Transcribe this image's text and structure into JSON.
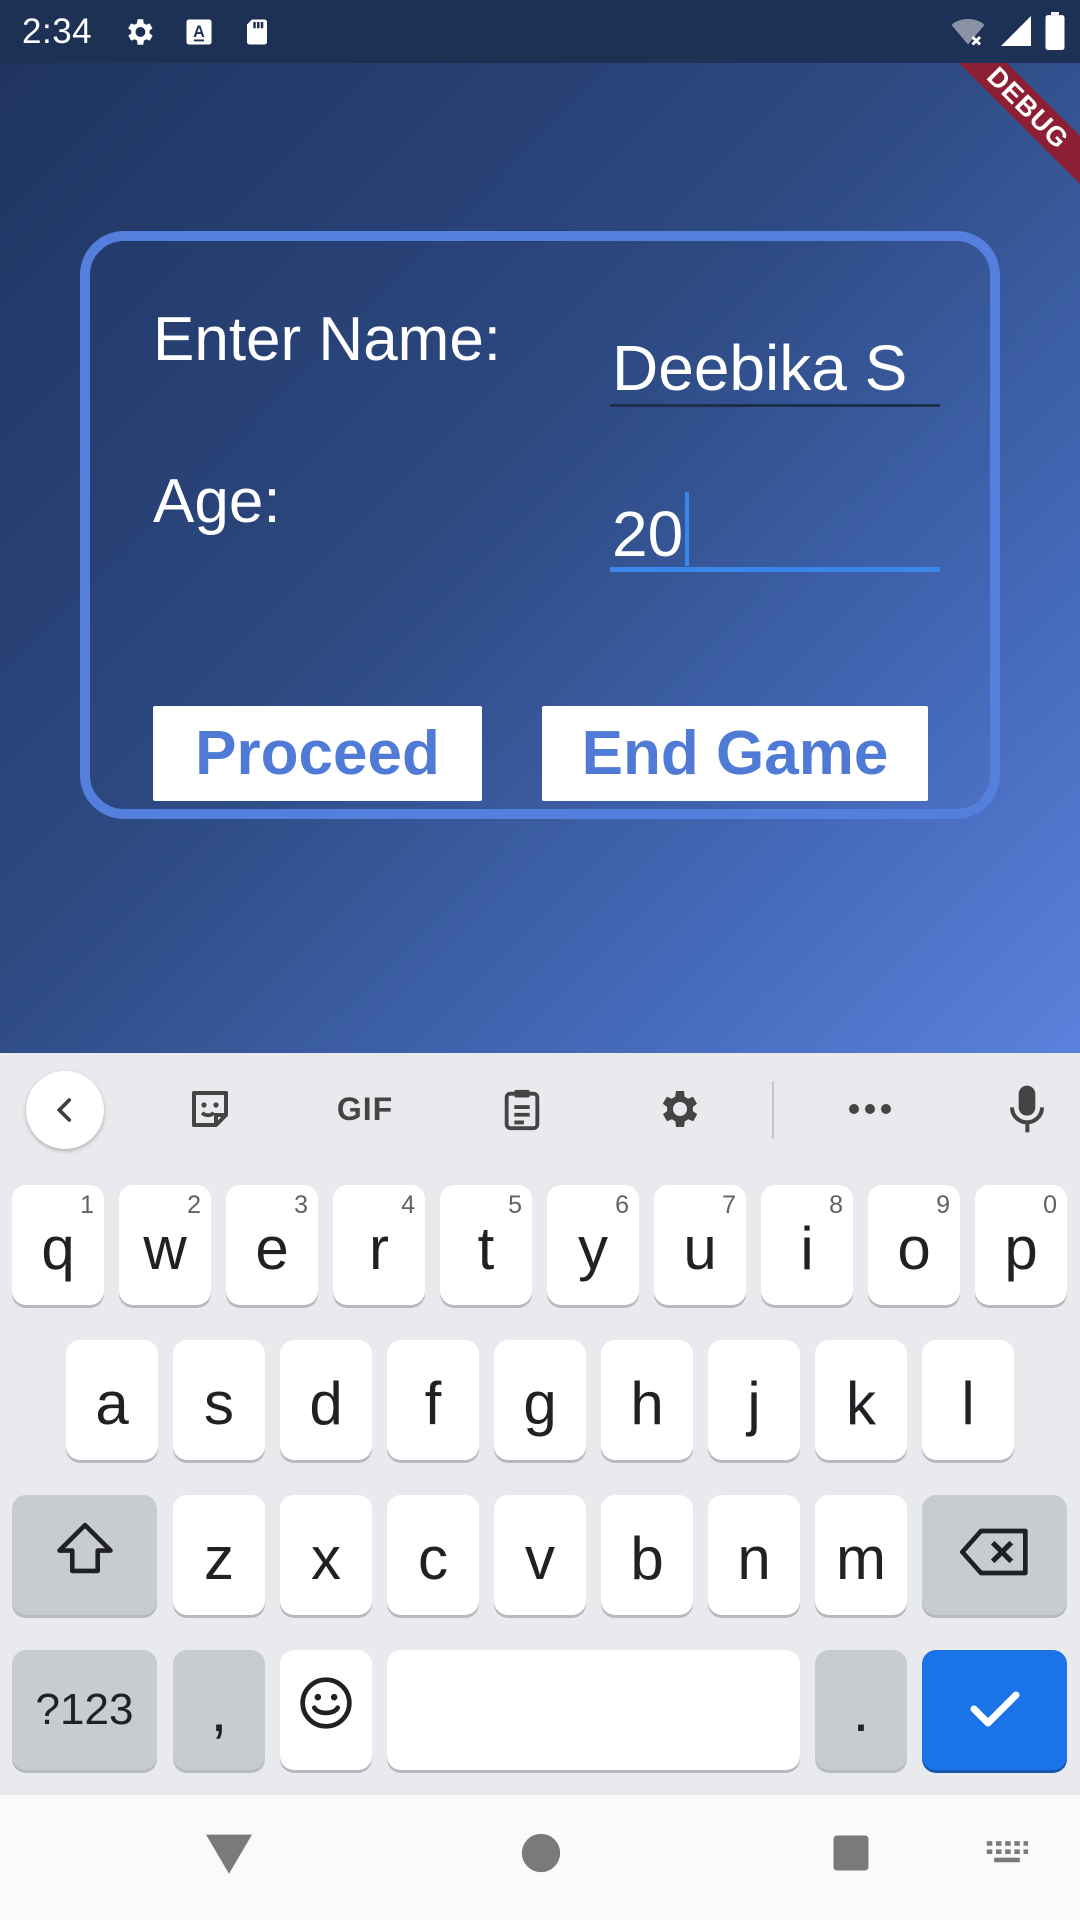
{
  "status_bar": {
    "time": "2:34",
    "icons": [
      "gear-icon",
      "a-icon",
      "sd-card-icon",
      "wifi-off-icon",
      "signal-icon",
      "battery-icon"
    ]
  },
  "debug_banner": "DEBUG",
  "form": {
    "name_label": "Enter Name:",
    "name_value": "Deebika S",
    "age_label": "Age:",
    "age_value": "20",
    "proceed_label": "Proceed",
    "end_game_label": "End Game"
  },
  "colors": {
    "card_border": "#557fdc",
    "button_text": "#4f7bd6",
    "accent": "#3b86ea",
    "keyboard_bg": "#e8eaed",
    "enter_key": "#1a73e8"
  },
  "keyboard": {
    "toolbar": {
      "gif_label": "GIF",
      "icons": [
        "back-chevron-icon",
        "sticker-icon",
        "clipboard-icon",
        "settings-icon",
        "more-icon",
        "mic-icon"
      ]
    },
    "row1": [
      {
        "key": "q",
        "hint": "1"
      },
      {
        "key": "w",
        "hint": "2"
      },
      {
        "key": "e",
        "hint": "3"
      },
      {
        "key": "r",
        "hint": "4"
      },
      {
        "key": "t",
        "hint": "5"
      },
      {
        "key": "y",
        "hint": "6"
      },
      {
        "key": "u",
        "hint": "7"
      },
      {
        "key": "i",
        "hint": "8"
      },
      {
        "key": "o",
        "hint": "9"
      },
      {
        "key": "p",
        "hint": "0"
      }
    ],
    "row2": [
      "a",
      "s",
      "d",
      "f",
      "g",
      "h",
      "j",
      "k",
      "l"
    ],
    "row3": [
      "z",
      "x",
      "c",
      "v",
      "b",
      "n",
      "m"
    ],
    "row4": {
      "symbols_label": "?123",
      "comma_label": ",",
      "period_label": "."
    }
  }
}
